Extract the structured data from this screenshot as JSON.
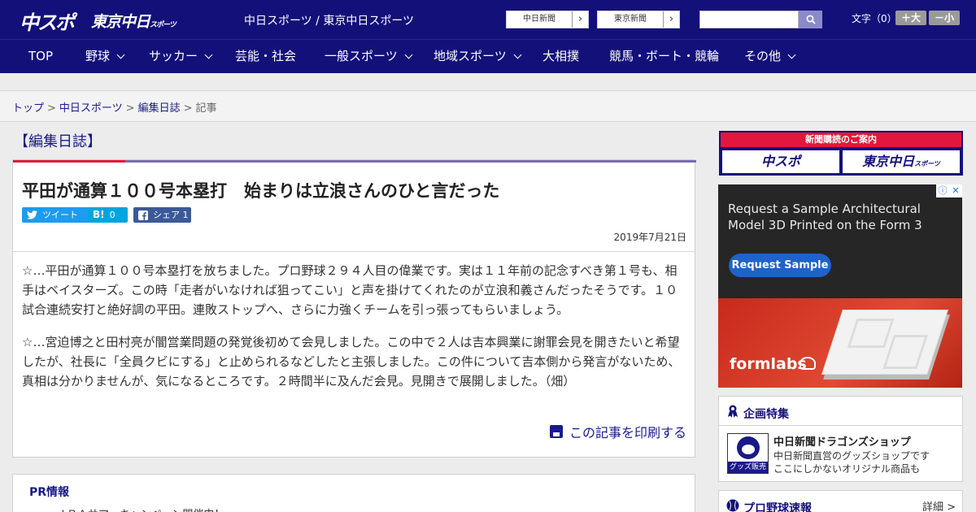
{
  "header": {
    "logo_primary": "中スポ",
    "logo_secondary": "東京中日",
    "logo_secondary_small": "スポーツ",
    "site_name": "中日スポーツ / 東京中日スポーツ",
    "buttons": [
      {
        "label": "中日新聞",
        "arrow": "›"
      },
      {
        "label": "東京新聞",
        "arrow": "›"
      }
    ],
    "search": {
      "placeholder": ""
    },
    "font_size": {
      "label": "文字（0）",
      "larger": "＋大",
      "smaller": "－小"
    }
  },
  "nav": {
    "items": [
      {
        "label": "TOP",
        "has_dropdown": false
      },
      {
        "label": "野球",
        "has_dropdown": true
      },
      {
        "label": "サッカー",
        "has_dropdown": true
      },
      {
        "label": "芸能・社会",
        "has_dropdown": false
      },
      {
        "label": "一般スポーツ",
        "has_dropdown": true
      },
      {
        "label": "地域スポーツ",
        "has_dropdown": true
      },
      {
        "label": "大相撲",
        "has_dropdown": false
      },
      {
        "label": "競馬・ボート・競輪",
        "has_dropdown": false
      },
      {
        "label": "その他",
        "has_dropdown": true
      }
    ]
  },
  "breadcrumb": {
    "items": [
      "トップ",
      "中日スポーツ",
      "編集日誌",
      "記事"
    ],
    "separator": ">"
  },
  "section_title": "【編集日誌】",
  "article": {
    "title": "平田が通算１００号本塁打　始まりは立浪さんのひと言だった",
    "share": {
      "tweet": "ツイート",
      "hatena_icon": "B!",
      "hatena_count": "0",
      "facebook": "シェア",
      "facebook_count": "1"
    },
    "date": "2019年7月21日",
    "paragraphs": [
      "☆…平田が通算１００号本塁打を放ちました。プロ野球２９４人目の偉業です。実は１１年前の記念すべき第１号も、相手はベイスターズ。この時「走者がいなければ狙ってこい」と声を掛けてくれたのが立浪和義さんだったそうです。１０試合連続安打と絶好調の平田。連敗ストップへ、さらに力強くチームを引っ張ってもらいましょう。",
      "☆…宮迫博之と田村亮が闇営業問題の発覚後初めて会見しました。この中で２人は吉本興業に謝罪会見を開きたいと希望したが、社長に「全員クビにする」と止められるなどしたと主張しました。この件について吉本側から発言がないため、真相は分かりませんが、気になるところです。２時間半に及んだ会見。見開きで展開しました。（畑）"
    ],
    "print_label": "この記事を印刷する"
  },
  "pr": {
    "title": "PR情報",
    "item": "・ＪＲＡサマーキャンペーン開催中！"
  },
  "sidebar": {
    "subscription": {
      "header": "新聞購読のご案内",
      "logo_left": "中スポ",
      "logo_right": "東京中日",
      "logo_right_small": "スポーツ"
    },
    "ad": {
      "headline": "Request a Sample Architectural Model 3D Printed on the Form 3",
      "cta": "Request Sample",
      "brand": "formlabs"
    },
    "features": {
      "title": "企画特集",
      "shop_name": "中日新聞ドラゴンズショップ",
      "shop_desc_1": "中日新聞直営のグッズショップです",
      "shop_desc_2": "ここにしかないオリジナル商品も",
      "thumb_tag": "グッズ販売中"
    },
    "baseball": {
      "title": "プロ野球速報",
      "detail": "詳細 >"
    }
  },
  "colors": {
    "brand_navy": "#14107a",
    "accent_red": "#e2173b",
    "accent_purple": "#7a6ab2",
    "twitter": "#1d9bf0",
    "hatena": "#00a4de",
    "facebook": "#3b5998"
  }
}
